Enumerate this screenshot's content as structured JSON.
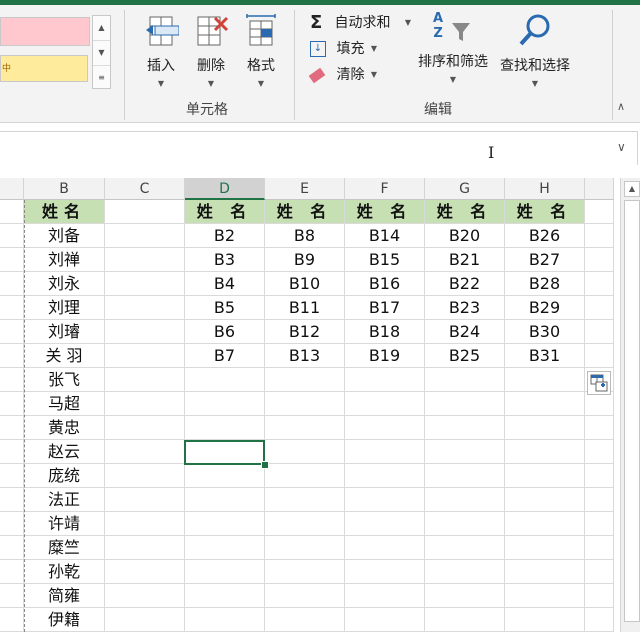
{
  "ribbon": {
    "insert_label": "插入",
    "delete_label": "删除",
    "format_label": "格式",
    "cells_group_label": "单元格",
    "autosum_label": "自动求和",
    "fill_label": "填充",
    "clear_label": "清除",
    "sort_filter_label": "排序和筛选",
    "find_select_label": "查找和选择",
    "editing_group_label": "编辑",
    "sigma_glyph": "Σ",
    "az_glyph": "A\nZ"
  },
  "columns": [
    "B",
    "C",
    "D",
    "E",
    "F",
    "G",
    "H"
  ],
  "selected_column": "D",
  "header_text": "姓名",
  "name_list": [
    "刘备",
    "刘禅",
    "刘永",
    "刘理",
    "刘璿",
    "关 羽",
    "张飞",
    "马超",
    "黄忠",
    "赵云",
    "庞统",
    "法正",
    "许靖",
    "糜竺",
    "孙乾",
    "简雍",
    "伊籍"
  ],
  "table": {
    "headers": [
      "姓 名",
      "姓 名",
      "姓 名",
      "姓 名",
      "姓 名"
    ],
    "rows": [
      [
        "B2",
        "B8",
        "B14",
        "B20",
        "B26"
      ],
      [
        "B3",
        "B9",
        "B15",
        "B21",
        "B27"
      ],
      [
        "B4",
        "B10",
        "B16",
        "B22",
        "B28"
      ],
      [
        "B5",
        "B11",
        "B17",
        "B23",
        "B29"
      ],
      [
        "B6",
        "B12",
        "B18",
        "B24",
        "B30"
      ],
      [
        "B7",
        "B13",
        "B19",
        "B25",
        "B31"
      ]
    ]
  },
  "colors": {
    "accent": "#217346",
    "header_fill": "#c6e0b4",
    "bad_style": "#ffc7ce",
    "neutral_style": "#ffeb9c"
  }
}
